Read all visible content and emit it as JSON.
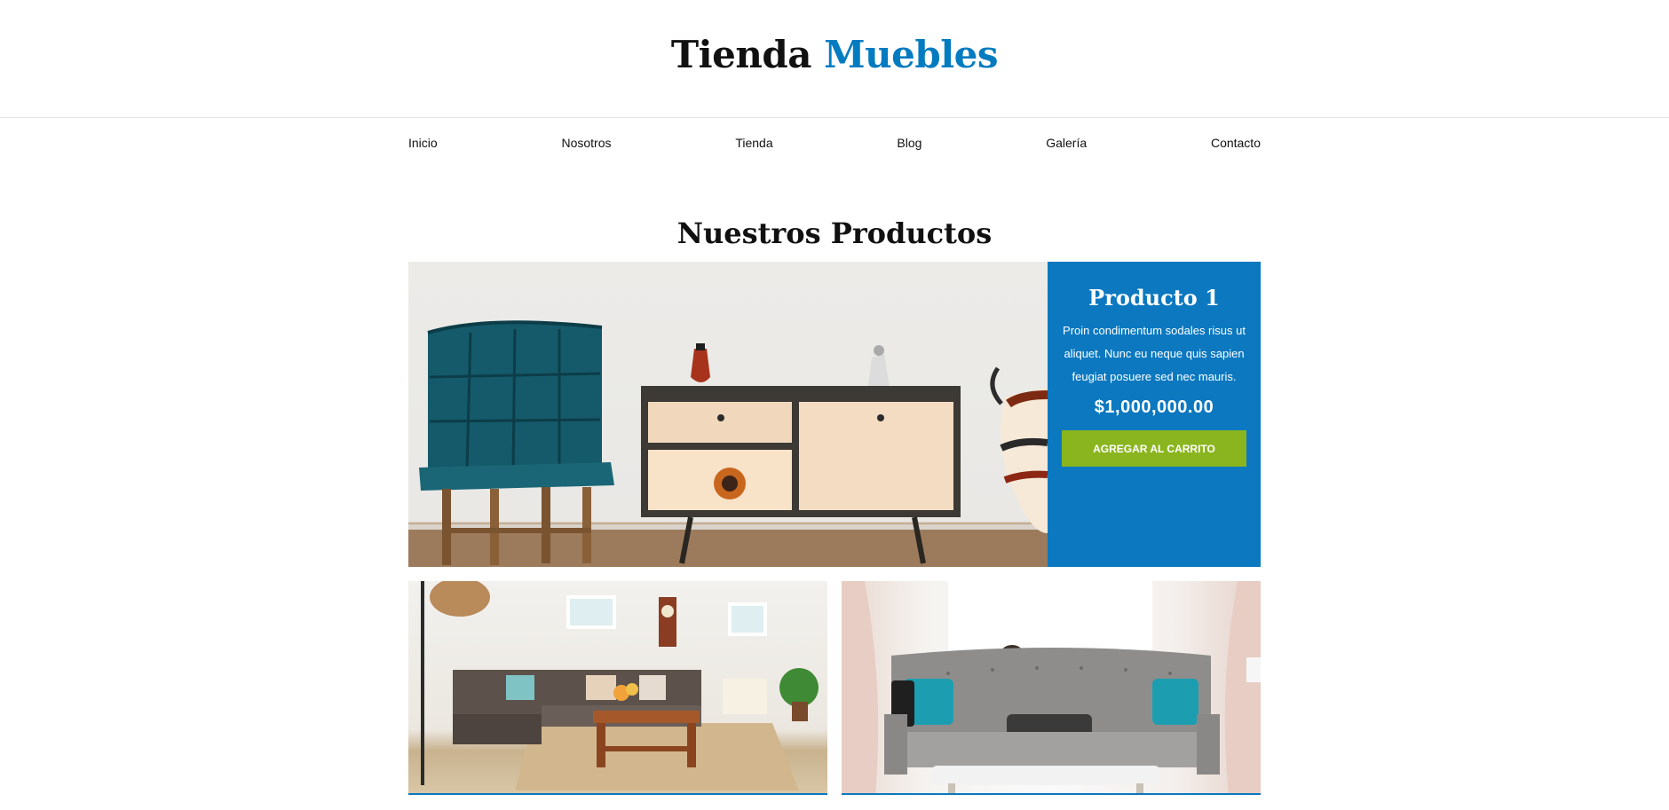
{
  "header": {
    "logo_part1": "Tienda",
    "logo_part2": "Muebles",
    "accent_color": "#037bc0"
  },
  "nav": {
    "items": [
      {
        "label": "Inicio"
      },
      {
        "label": "Nosotros"
      },
      {
        "label": "Tienda"
      },
      {
        "label": "Blog"
      },
      {
        "label": "Galería"
      },
      {
        "label": "Contacto"
      }
    ]
  },
  "products_section": {
    "title": "Nuestros Productos"
  },
  "featured_product": {
    "name": "Producto 1",
    "description": "Proin condimentum sodales risus ut aliquet. Nunc eu neque quis sapien feugiat posuere sed nec mauris.",
    "price": "$1,000,000.00",
    "button_label": "Agregar al carrito",
    "panel_color": "#0b78c0",
    "button_color": "#8ab51f"
  }
}
